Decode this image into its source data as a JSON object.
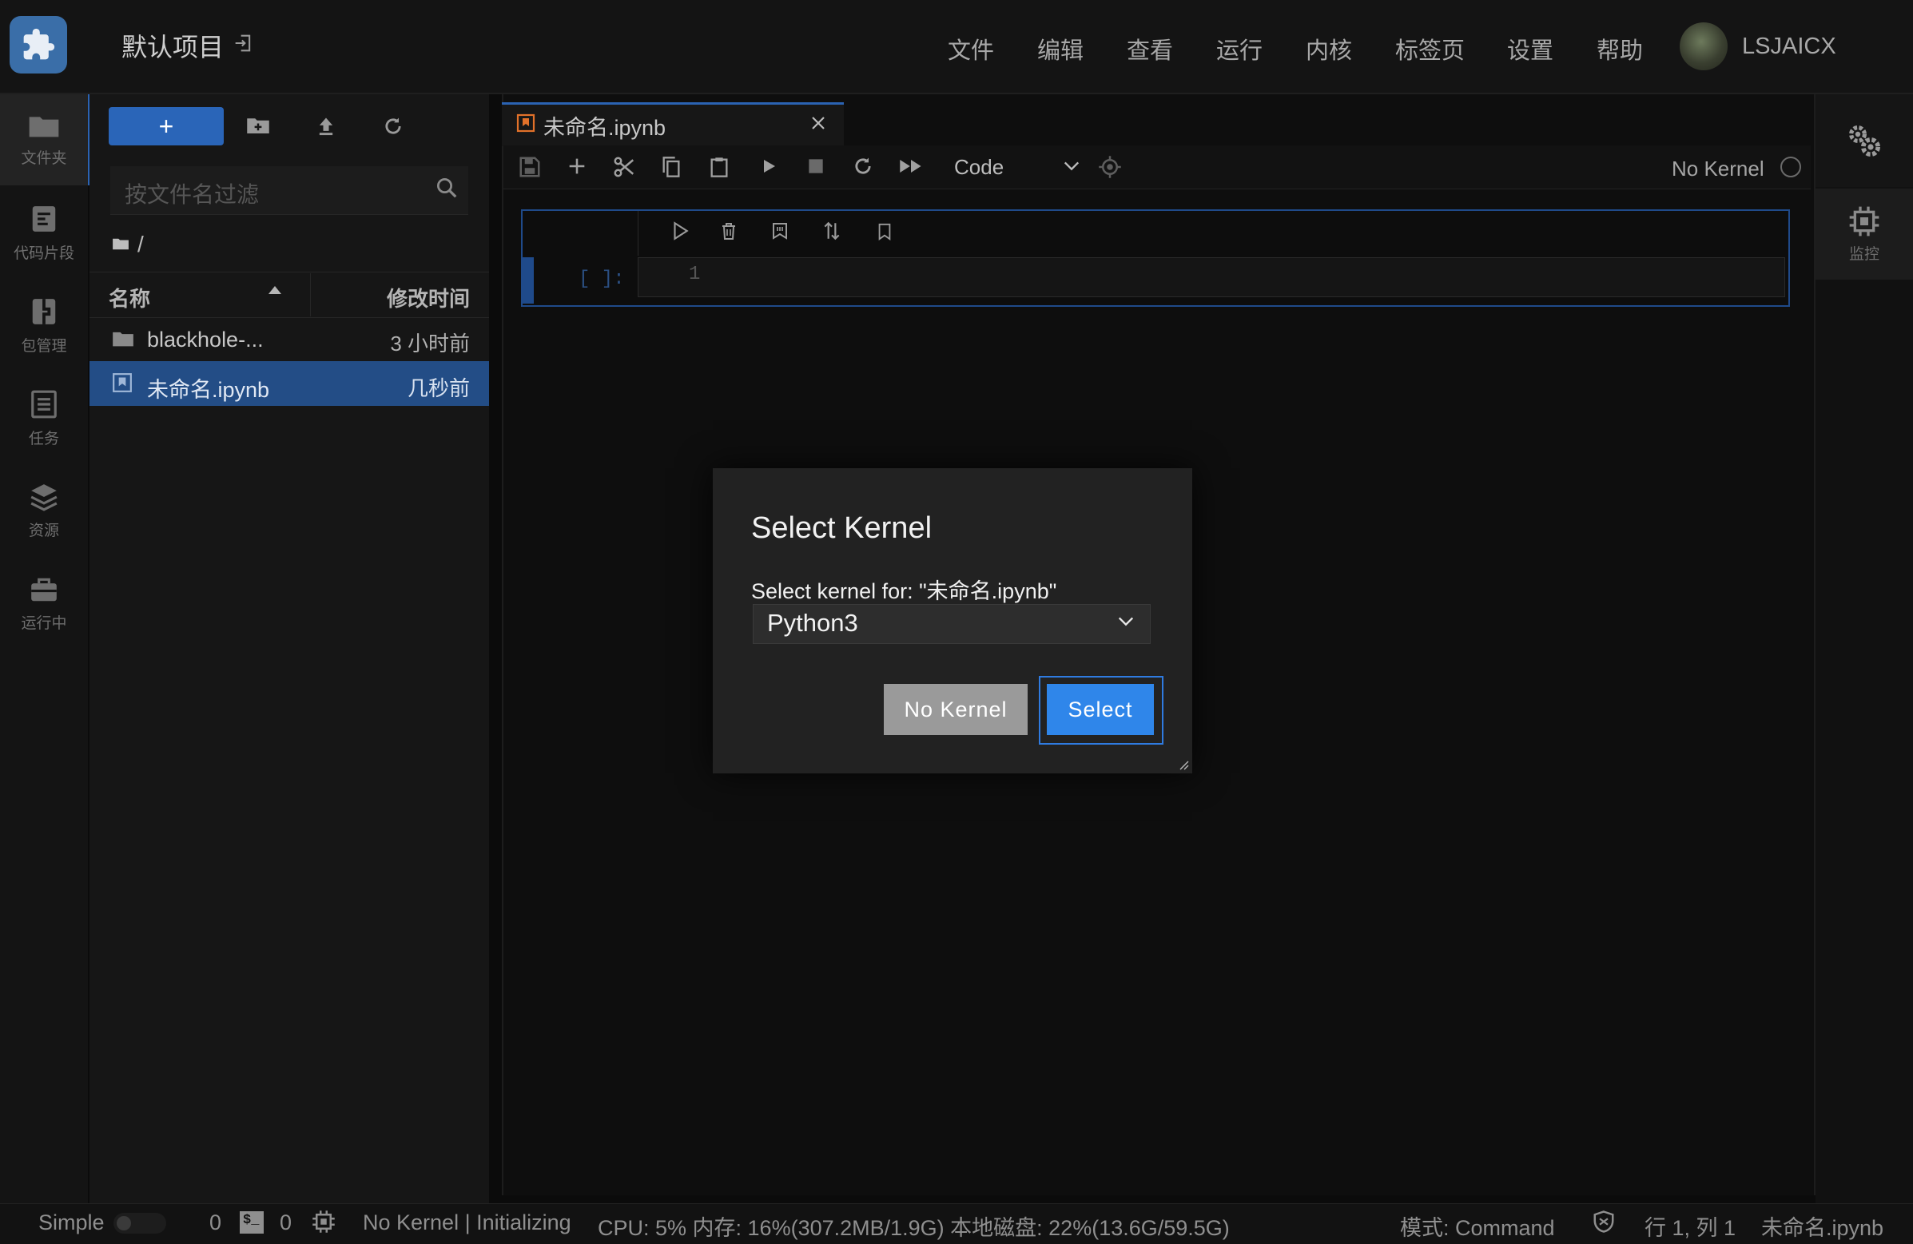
{
  "app": {
    "project_title": "默认项目",
    "username": "LSJAICX"
  },
  "menu": [
    "文件",
    "编辑",
    "查看",
    "运行",
    "内核",
    "标签页",
    "设置",
    "帮助"
  ],
  "rail": [
    {
      "label": "文件夹",
      "icon": "folder-icon"
    },
    {
      "label": "代码片段",
      "icon": "snippet-icon"
    },
    {
      "label": "包管理",
      "icon": "package-icon"
    },
    {
      "label": "任务",
      "icon": "task-icon"
    },
    {
      "label": "资源",
      "icon": "layers-icon"
    },
    {
      "label": "运行中",
      "icon": "briefcase-icon"
    }
  ],
  "filebrowser": {
    "new_label": "+",
    "filter_placeholder": "按文件名过滤",
    "breadcrumb": "/",
    "columns": {
      "name": "名称",
      "modified": "修改时间"
    },
    "files": [
      {
        "name": "blackhole-...",
        "modified": "3 小时前",
        "type": "folder",
        "selected": false
      },
      {
        "name": "未命名.ipynb",
        "modified": "几秒前",
        "type": "notebook",
        "selected": true
      }
    ]
  },
  "notebook": {
    "tab_title": "未命名.ipynb",
    "cell_type": "Code",
    "kernel_status": "No Kernel",
    "cell_prompt": "[ ]:",
    "line_number": "1"
  },
  "right_panel": {
    "monitor_label": "监控"
  },
  "dialog": {
    "title": "Select Kernel",
    "label": "Select kernel for: \"未命名.ipynb\"",
    "selected_kernel": "Python3",
    "no_kernel_button": "No Kernel",
    "select_button": "Select"
  },
  "statusbar": {
    "mode_simple": "Simple",
    "terminals_count": "0",
    "kernels_count": "0",
    "kernel_state": "No Kernel | Initializing",
    "resources": "CPU: 5% 内存: 16%(307.2MB/1.9G) 本地磁盘: 22%(13.6G/59.5G)",
    "mode": "模式: Command",
    "cursor": "行 1, 列 1",
    "file": "未命名.ipynb"
  },
  "colors": {
    "accent": "#2b63b3",
    "select_button": "#2f86ea",
    "no_kernel_button": "#9a9a9a"
  }
}
